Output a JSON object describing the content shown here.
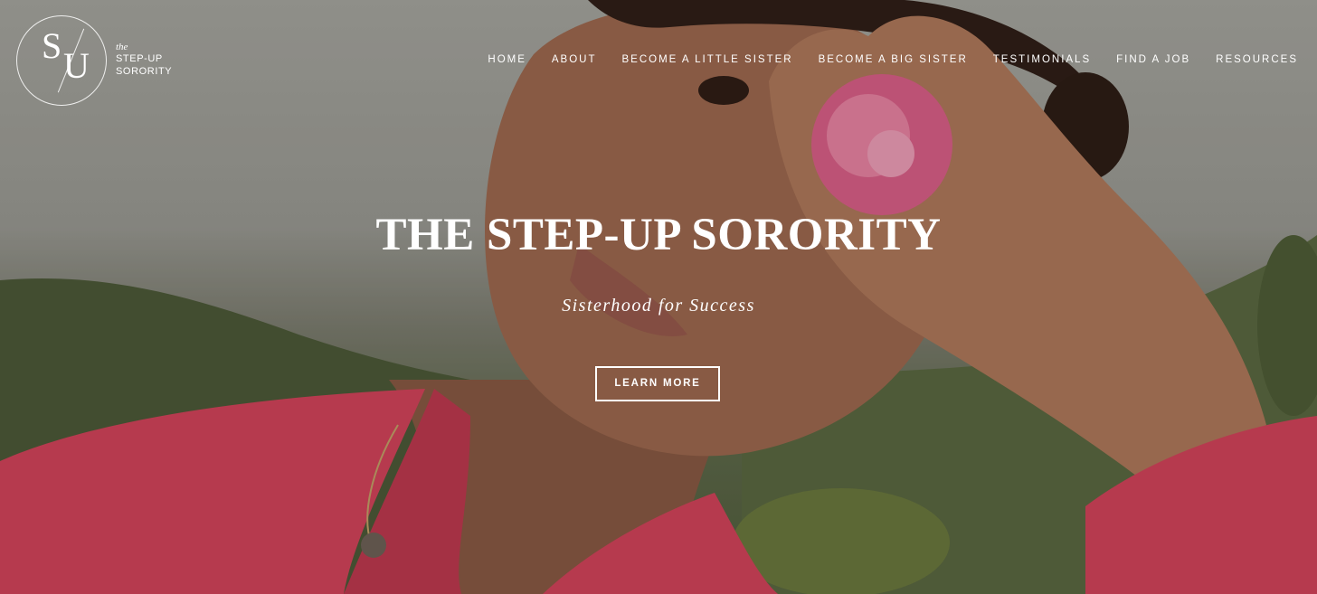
{
  "logo": {
    "monogram_s": "S",
    "monogram_u": "U",
    "the": "the",
    "line1": "STEP-UP",
    "line2": "SORORITY"
  },
  "nav": {
    "items": [
      {
        "label": "HOME"
      },
      {
        "label": "ABOUT"
      },
      {
        "label": "BECOME A LITTLE SISTER"
      },
      {
        "label": "BECOME A BIG SISTER"
      },
      {
        "label": "TESTIMONIALS"
      },
      {
        "label": "FIND A JOB"
      },
      {
        "label": "RESOURCES"
      }
    ]
  },
  "hero": {
    "title": "THE STEP-UP SORORITY",
    "subtitle": "Sisterhood for Success",
    "cta_label": "LEARN MORE",
    "image_icon": "portrait-photo-icon"
  },
  "colors": {
    "text": "#ffffff",
    "blazer": "#d8435c",
    "flower": "#e0608c",
    "sky": "#a9aaa4",
    "foliage": "#55653f"
  }
}
